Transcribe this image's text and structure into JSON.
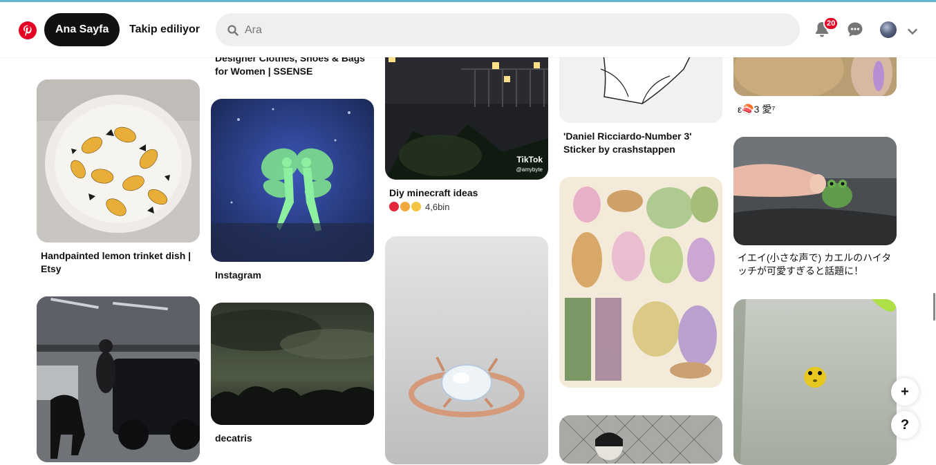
{
  "header": {
    "nav_home": "Ana Sayfa",
    "nav_following": "Takip ediliyor",
    "search_placeholder": "Ara",
    "notifications_count": "20"
  },
  "pins": {
    "col1": [
      {
        "title": "Handpainted lemon trinket dish | Etsy"
      },
      {
        "title": ""
      }
    ],
    "col2": [
      {
        "title": "Designer Clothes, Shoes & Bags for Women | SSENSE"
      },
      {
        "title": "Instagram"
      },
      {
        "title": "decatris"
      }
    ],
    "col3": [
      {
        "title": "Diy minecraft ideas",
        "reactions": "4,6bin",
        "badge_text": "TikTok",
        "badge_user": "@amybyte"
      }
    ],
    "col4": [
      {
        "title": "'Daniel Ricciardo-Number 3' Sticker by crashstappen"
      }
    ],
    "col5": [
      {
        "title": "ε🍣3 愛⁷"
      },
      {
        "title": "イエイ(小さな声で) カエルのハイタッチが可愛すぎると話題に！"
      }
    ]
  },
  "floating": {
    "add_symbol": "+",
    "help_symbol": "?"
  },
  "colors": {
    "brand": "#e60023",
    "accent_topline": "#63b5cf",
    "search_bg": "#efefef"
  }
}
